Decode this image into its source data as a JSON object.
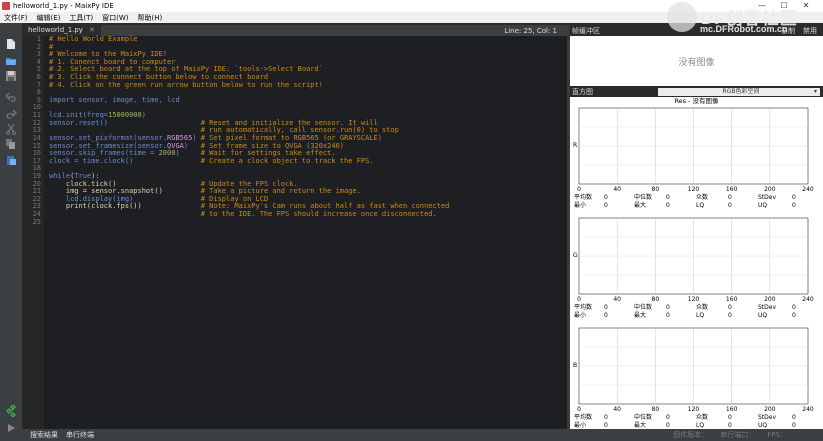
{
  "window": {
    "title": "helloworld_1.py - MaixPy IDE",
    "controls": [
      "—",
      "☐",
      "✕"
    ]
  },
  "menu": {
    "items": [
      "文件(F)",
      "编辑(E)",
      "工具(T)",
      "窗口(W)",
      "帮助(H)"
    ]
  },
  "watermark": {
    "brand": "DF创客社区",
    "url": "mc.DFRobot.com.cn"
  },
  "toolbar": {
    "icons": [
      "new-file-icon",
      "open-folder-icon",
      "save-icon",
      "undo-icon",
      "redo-icon",
      "cut-icon",
      "copy-icon",
      "paste-icon",
      "connect-icon",
      "run-icon"
    ]
  },
  "editor": {
    "tab_name": "helloworld_1.py",
    "tab_close": "✕",
    "cursor_position": "Line: 25, Col: 1",
    "line_numbers": [
      "1",
      "2",
      "3",
      "4",
      "5",
      "6",
      "7",
      "8",
      "9",
      "10",
      "11",
      "12",
      "13",
      "14",
      "15",
      "16",
      "17",
      "18",
      "19",
      "20",
      "21",
      "22",
      "23",
      "24",
      "25"
    ],
    "lines": [
      [
        {
          "t": "# Hello World Example",
          "c": "cm"
        }
      ],
      [
        {
          "t": "#",
          "c": "cm"
        }
      ],
      [
        {
          "t": "# Welcome to the MaixPy IDE!",
          "c": "cm"
        }
      ],
      [
        {
          "t": "# 1. Conenct board to computer",
          "c": "cm"
        }
      ],
      [
        {
          "t": "# 2. Select board at the top of MaixPy IDE: `tools->Select Board`",
          "c": "cm"
        }
      ],
      [
        {
          "t": "# 3. Click the connect button below to connect board",
          "c": "cm"
        }
      ],
      [
        {
          "t": "# 4. Click on the green run arrow button below to run the script!",
          "c": "cm"
        }
      ],
      [],
      [
        {
          "t": "import ",
          "c": "kw"
        },
        {
          "t": "sensor, image, time, lcd",
          "c": "kw"
        }
      ],
      [],
      [
        {
          "t": "lcd.init(freq=",
          "c": "kw"
        },
        {
          "t": "15000000",
          "c": "nm"
        },
        {
          "t": ")",
          "c": "kw"
        }
      ],
      [
        {
          "t": "sensor.reset()",
          "c": "kw"
        },
        {
          "t": "                      # Reset and initialize the sensor. It will",
          "c": "cm"
        }
      ],
      [
        {
          "t": "                                    # run automatically, call sensor.run(0) to stop",
          "c": "cm"
        }
      ],
      [
        {
          "t": "sensor.set_pixformat(sensor.",
          "c": "kw"
        },
        {
          "t": "RGB565",
          "c": "cn"
        },
        {
          "t": ")",
          "c": "kw"
        },
        {
          "t": " # Set pixel format to RGB565 (or GRAYSCALE)",
          "c": "cm"
        }
      ],
      [
        {
          "t": "sensor.set_framesize(sensor.",
          "c": "kw"
        },
        {
          "t": "QVGA",
          "c": "cn"
        },
        {
          "t": ")",
          "c": "kw"
        },
        {
          "t": "   # Set frame size to QVGA (320x240)",
          "c": "cm"
        }
      ],
      [
        {
          "t": "sensor.skip_frames(time = ",
          "c": "kw"
        },
        {
          "t": "2000",
          "c": "nm"
        },
        {
          "t": ")",
          "c": "kw"
        },
        {
          "t": "     # Wait for settings take effect.",
          "c": "cm"
        }
      ],
      [
        {
          "t": "clock = time.clock()",
          "c": "kw"
        },
        {
          "t": "                # Create a clock object to track the FPS.",
          "c": "cm"
        }
      ],
      [],
      [
        {
          "t": "while",
          "c": "kw"
        },
        {
          "t": "(",
          "c": "fn"
        },
        {
          "t": "True",
          "c": "kw"
        },
        {
          "t": "):",
          "c": "fn"
        }
      ],
      [
        {
          "t": "    clock.tick()",
          "c": "fn"
        },
        {
          "t": "                    # Update the FPS clock.",
          "c": "cm"
        }
      ],
      [
        {
          "t": "    img = sensor.snapshot()",
          "c": "fn"
        },
        {
          "t": "         # Take a picture and return the image.",
          "c": "cm"
        }
      ],
      [
        {
          "t": "    lcd.display(img)",
          "c": "kw"
        },
        {
          "t": "                # Display on LCD",
          "c": "cm"
        }
      ],
      [
        {
          "t": "    print(clock.fps())",
          "c": "fn"
        },
        {
          "t": "              # Note: MaixPy's Cam runs about half as fast when connected",
          "c": "cm"
        }
      ],
      [
        {
          "t": "                                    # to the IDE. The FPS should increase once disconnected.",
          "c": "cm"
        }
      ],
      []
    ]
  },
  "status_bar": {
    "left_items": [
      "搜索结果",
      "串行终端"
    ],
    "right_items": [
      "固件版本：",
      "串行端口：",
      "FPS："
    ]
  },
  "frame_buffer": {
    "label": "帧缓冲区",
    "controls": [
      "录制",
      "禁用"
    ],
    "placeholder": "没有图像"
  },
  "histogram": {
    "label": "直方图",
    "colorspace": "RGB色彩空间",
    "title": "Res - 没有图像",
    "x_ticks": [
      "0",
      "40",
      "80",
      "120",
      "160",
      "200",
      "240"
    ],
    "channels": [
      {
        "axis_label": "R",
        "row1": [
          {
            "k": "平均数",
            "v": "0"
          },
          {
            "k": "中位数",
            "v": "0"
          },
          {
            "k": "众数",
            "v": "0"
          },
          {
            "k": "StDev",
            "v": "0"
          }
        ],
        "row2": [
          {
            "k": "最小",
            "v": "0"
          },
          {
            "k": "最大",
            "v": "0"
          },
          {
            "k": "LQ",
            "v": "0"
          },
          {
            "k": "UQ",
            "v": "0"
          }
        ]
      },
      {
        "axis_label": "G",
        "row1": [
          {
            "k": "平均数",
            "v": "0"
          },
          {
            "k": "中位数",
            "v": "0"
          },
          {
            "k": "众数",
            "v": "0"
          },
          {
            "k": "StDev",
            "v": "0"
          }
        ],
        "row2": [
          {
            "k": "最小",
            "v": "0"
          },
          {
            "k": "最大",
            "v": "0"
          },
          {
            "k": "LQ",
            "v": "0"
          },
          {
            "k": "UQ",
            "v": "0"
          }
        ]
      },
      {
        "axis_label": "B",
        "row1": [
          {
            "k": "平均数",
            "v": "0"
          },
          {
            "k": "中位数",
            "v": "0"
          },
          {
            "k": "众数",
            "v": "0"
          },
          {
            "k": "StDev",
            "v": "0"
          }
        ],
        "row2": [
          {
            "k": "最小",
            "v": "0"
          },
          {
            "k": "最大",
            "v": "0"
          },
          {
            "k": "LQ",
            "v": "0"
          },
          {
            "k": "UQ",
            "v": "0"
          }
        ]
      }
    ]
  }
}
